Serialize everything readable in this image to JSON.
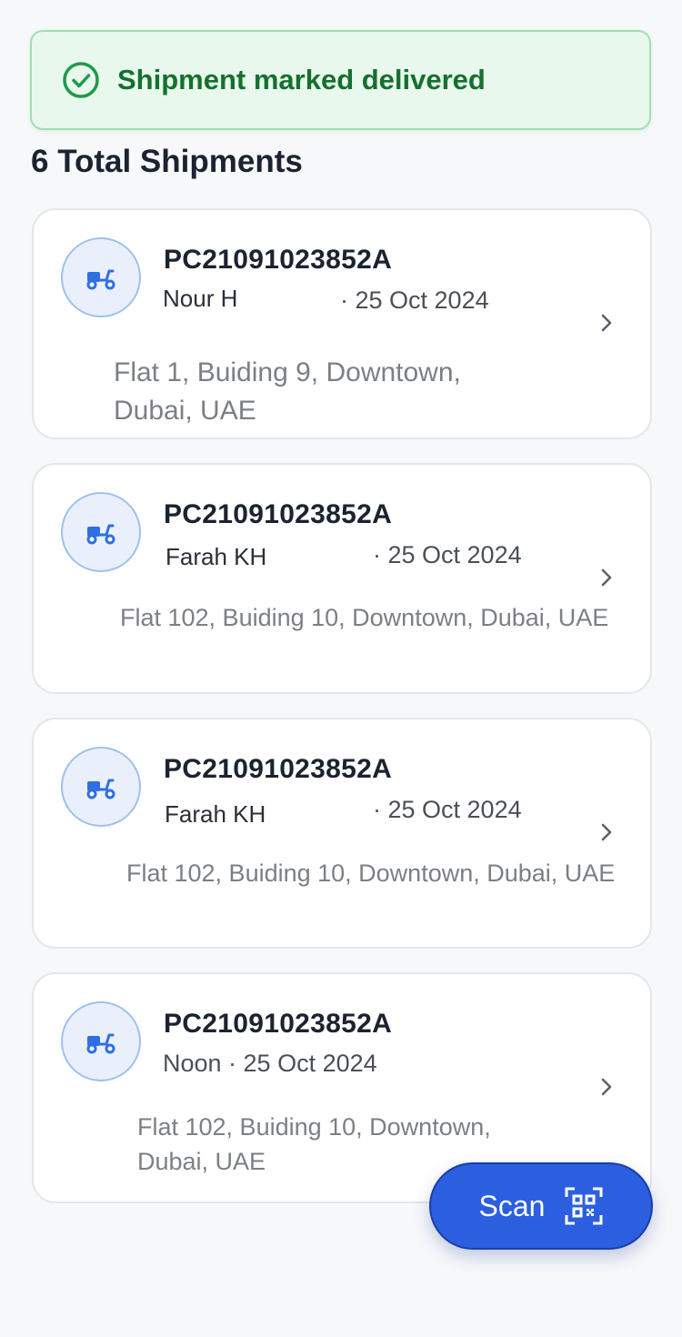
{
  "toast": {
    "message": "Shipment marked delivered",
    "icon": "check-circle-icon"
  },
  "summary": {
    "total_label": "6 Total Shipments"
  },
  "shipments": [
    {
      "tracking": "PC21091023852A",
      "name": "Nour H",
      "date": "· 25 Oct 2024",
      "address": "Flat 1, Buiding 9, Downtown, Dubai, UAE",
      "icon": "scooter-icon"
    },
    {
      "tracking": "PC21091023852A",
      "name": "Farah KH",
      "date": "· 25 Oct 2024",
      "address": "Flat 102, Buiding 10, Downtown, Dubai, UAE",
      "icon": "scooter-icon"
    },
    {
      "tracking": "PC21091023852A",
      "name": "Farah KH",
      "date": "· 25 Oct 2024",
      "address": "Flat 102, Buiding 10, Downtown, Dubai, UAE",
      "icon": "scooter-icon"
    },
    {
      "tracking": "PC21091023852A",
      "meta": "Noon · 25 Oct 2024",
      "address": "Flat 102, Buiding 10, Downtown, Dubai, UAE",
      "icon": "scooter-icon"
    }
  ],
  "scan_button": {
    "label": "Scan",
    "icon": "qr-code-icon"
  },
  "colors": {
    "accent": "#2b5fe0",
    "success_bg": "#e8f8ec",
    "success_text": "#15702f",
    "icon_blue": "#2f6fe4"
  }
}
